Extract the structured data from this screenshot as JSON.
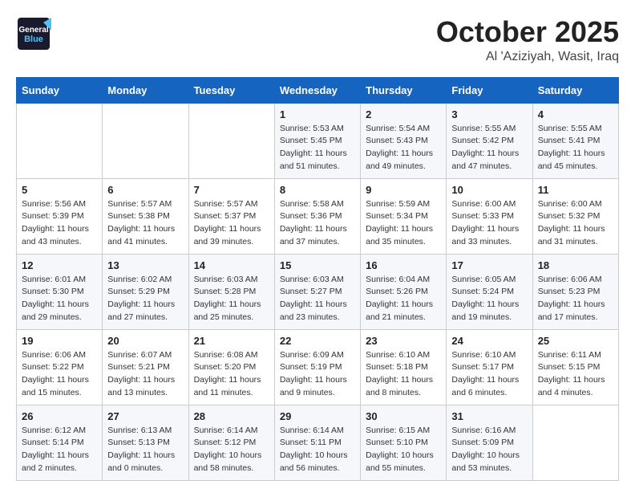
{
  "header": {
    "logo_line1": "General",
    "logo_line2": "Blue",
    "month": "October 2025",
    "location": "Al 'Aziziyah, Wasit, Iraq"
  },
  "weekdays": [
    "Sunday",
    "Monday",
    "Tuesday",
    "Wednesday",
    "Thursday",
    "Friday",
    "Saturday"
  ],
  "weeks": [
    [
      {
        "day": "",
        "info": ""
      },
      {
        "day": "",
        "info": ""
      },
      {
        "day": "",
        "info": ""
      },
      {
        "day": "1",
        "info": "Sunrise: 5:53 AM\nSunset: 5:45 PM\nDaylight: 11 hours\nand 51 minutes."
      },
      {
        "day": "2",
        "info": "Sunrise: 5:54 AM\nSunset: 5:43 PM\nDaylight: 11 hours\nand 49 minutes."
      },
      {
        "day": "3",
        "info": "Sunrise: 5:55 AM\nSunset: 5:42 PM\nDaylight: 11 hours\nand 47 minutes."
      },
      {
        "day": "4",
        "info": "Sunrise: 5:55 AM\nSunset: 5:41 PM\nDaylight: 11 hours\nand 45 minutes."
      }
    ],
    [
      {
        "day": "5",
        "info": "Sunrise: 5:56 AM\nSunset: 5:39 PM\nDaylight: 11 hours\nand 43 minutes."
      },
      {
        "day": "6",
        "info": "Sunrise: 5:57 AM\nSunset: 5:38 PM\nDaylight: 11 hours\nand 41 minutes."
      },
      {
        "day": "7",
        "info": "Sunrise: 5:57 AM\nSunset: 5:37 PM\nDaylight: 11 hours\nand 39 minutes."
      },
      {
        "day": "8",
        "info": "Sunrise: 5:58 AM\nSunset: 5:36 PM\nDaylight: 11 hours\nand 37 minutes."
      },
      {
        "day": "9",
        "info": "Sunrise: 5:59 AM\nSunset: 5:34 PM\nDaylight: 11 hours\nand 35 minutes."
      },
      {
        "day": "10",
        "info": "Sunrise: 6:00 AM\nSunset: 5:33 PM\nDaylight: 11 hours\nand 33 minutes."
      },
      {
        "day": "11",
        "info": "Sunrise: 6:00 AM\nSunset: 5:32 PM\nDaylight: 11 hours\nand 31 minutes."
      }
    ],
    [
      {
        "day": "12",
        "info": "Sunrise: 6:01 AM\nSunset: 5:30 PM\nDaylight: 11 hours\nand 29 minutes."
      },
      {
        "day": "13",
        "info": "Sunrise: 6:02 AM\nSunset: 5:29 PM\nDaylight: 11 hours\nand 27 minutes."
      },
      {
        "day": "14",
        "info": "Sunrise: 6:03 AM\nSunset: 5:28 PM\nDaylight: 11 hours\nand 25 minutes."
      },
      {
        "day": "15",
        "info": "Sunrise: 6:03 AM\nSunset: 5:27 PM\nDaylight: 11 hours\nand 23 minutes."
      },
      {
        "day": "16",
        "info": "Sunrise: 6:04 AM\nSunset: 5:26 PM\nDaylight: 11 hours\nand 21 minutes."
      },
      {
        "day": "17",
        "info": "Sunrise: 6:05 AM\nSunset: 5:24 PM\nDaylight: 11 hours\nand 19 minutes."
      },
      {
        "day": "18",
        "info": "Sunrise: 6:06 AM\nSunset: 5:23 PM\nDaylight: 11 hours\nand 17 minutes."
      }
    ],
    [
      {
        "day": "19",
        "info": "Sunrise: 6:06 AM\nSunset: 5:22 PM\nDaylight: 11 hours\nand 15 minutes."
      },
      {
        "day": "20",
        "info": "Sunrise: 6:07 AM\nSunset: 5:21 PM\nDaylight: 11 hours\nand 13 minutes."
      },
      {
        "day": "21",
        "info": "Sunrise: 6:08 AM\nSunset: 5:20 PM\nDaylight: 11 hours\nand 11 minutes."
      },
      {
        "day": "22",
        "info": "Sunrise: 6:09 AM\nSunset: 5:19 PM\nDaylight: 11 hours\nand 9 minutes."
      },
      {
        "day": "23",
        "info": "Sunrise: 6:10 AM\nSunset: 5:18 PM\nDaylight: 11 hours\nand 8 minutes."
      },
      {
        "day": "24",
        "info": "Sunrise: 6:10 AM\nSunset: 5:17 PM\nDaylight: 11 hours\nand 6 minutes."
      },
      {
        "day": "25",
        "info": "Sunrise: 6:11 AM\nSunset: 5:15 PM\nDaylight: 11 hours\nand 4 minutes."
      }
    ],
    [
      {
        "day": "26",
        "info": "Sunrise: 6:12 AM\nSunset: 5:14 PM\nDaylight: 11 hours\nand 2 minutes."
      },
      {
        "day": "27",
        "info": "Sunrise: 6:13 AM\nSunset: 5:13 PM\nDaylight: 11 hours\nand 0 minutes."
      },
      {
        "day": "28",
        "info": "Sunrise: 6:14 AM\nSunset: 5:12 PM\nDaylight: 10 hours\nand 58 minutes."
      },
      {
        "day": "29",
        "info": "Sunrise: 6:14 AM\nSunset: 5:11 PM\nDaylight: 10 hours\nand 56 minutes."
      },
      {
        "day": "30",
        "info": "Sunrise: 6:15 AM\nSunset: 5:10 PM\nDaylight: 10 hours\nand 55 minutes."
      },
      {
        "day": "31",
        "info": "Sunrise: 6:16 AM\nSunset: 5:09 PM\nDaylight: 10 hours\nand 53 minutes."
      },
      {
        "day": "",
        "info": ""
      }
    ]
  ]
}
